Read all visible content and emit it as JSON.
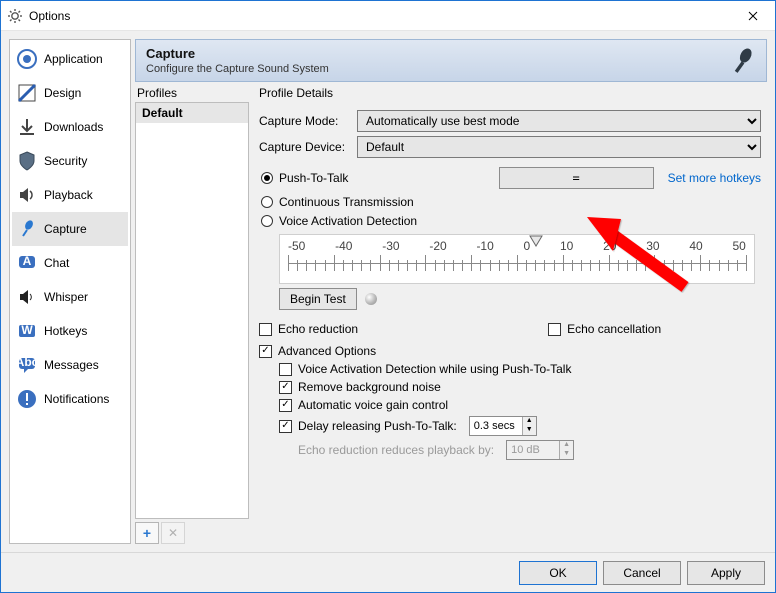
{
  "window": {
    "title": "Options"
  },
  "sidebar": {
    "items": [
      {
        "label": "Application"
      },
      {
        "label": "Design"
      },
      {
        "label": "Downloads"
      },
      {
        "label": "Security"
      },
      {
        "label": "Playback"
      },
      {
        "label": "Capture"
      },
      {
        "label": "Chat"
      },
      {
        "label": "Whisper"
      },
      {
        "label": "Hotkeys"
      },
      {
        "label": "Messages"
      },
      {
        "label": "Notifications"
      }
    ]
  },
  "banner": {
    "title": "Capture",
    "subtitle": "Configure the Capture Sound System"
  },
  "profiles": {
    "header": "Profiles",
    "items": [
      "Default"
    ],
    "add": "+",
    "del": "✕"
  },
  "details": {
    "header": "Profile Details",
    "capture_mode_label": "Capture Mode:",
    "capture_mode_value": "Automatically use best mode",
    "capture_device_label": "Capture Device:",
    "capture_device_value": "Default",
    "radios": {
      "ptt": "Push-To-Talk",
      "cont": "Continuous Transmission",
      "vad": "Voice Activation Detection"
    },
    "hotkey_value": "=",
    "more_hotkeys": "Set more hotkeys",
    "scale": {
      "labels": [
        "-50",
        "-40",
        "-30",
        "-20",
        "-10",
        "0",
        "10",
        "20",
        "30",
        "40",
        "50"
      ]
    },
    "begin_test": "Begin Test",
    "echo_reduction": "Echo reduction",
    "echo_cancellation": "Echo cancellation",
    "advanced": "Advanced Options",
    "adv": {
      "vad_ptt": "Voice Activation Detection while using Push-To-Talk",
      "bgn": "Remove background noise",
      "agc": "Automatic voice gain control",
      "delay_label": "Delay releasing Push-To-Talk:",
      "delay_value": "0.3 secs",
      "echo_red_label": "Echo reduction reduces playback by:",
      "echo_red_value": "10 dB"
    }
  },
  "footer": {
    "ok": "OK",
    "cancel": "Cancel",
    "apply": "Apply"
  }
}
